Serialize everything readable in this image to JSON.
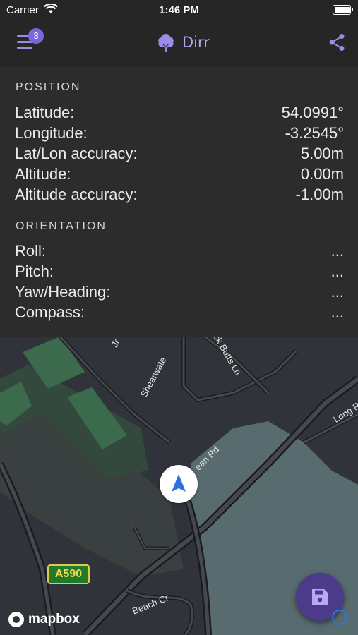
{
  "status_bar": {
    "carrier": "Carrier",
    "time": "1:46 PM"
  },
  "nav": {
    "badge_count": "3",
    "app_name": "Dirr",
    "accent": "#9d8bea"
  },
  "position": {
    "title": "POSITION",
    "rows": [
      {
        "label": "Latitude:",
        "value": "54.0991°"
      },
      {
        "label": "Longitude:",
        "value": "-3.2545°"
      },
      {
        "label": "Lat/Lon accuracy:",
        "value": "5.00m"
      },
      {
        "label": "Altitude:",
        "value": "0.00m"
      },
      {
        "label": "Altitude accuracy:",
        "value": "-1.00m"
      }
    ]
  },
  "orientation": {
    "title": "ORIENTATION",
    "rows": [
      {
        "label": "Roll:",
        "value": "..."
      },
      {
        "label": "Pitch:",
        "value": "..."
      },
      {
        "label": "Yaw/Heading:",
        "value": "..."
      },
      {
        "label": "Compass:",
        "value": "..."
      }
    ]
  },
  "map": {
    "road_labels": {
      "shearwater": "Shearwate",
      "butts": "ck Butts Ln",
      "ocean": "ean Rd",
      "long": "Long R",
      "beach": "Beach Cr",
      "jr": "Jr"
    },
    "road_sign": "A590",
    "attribution": "mapbox",
    "info": "i"
  },
  "icons": {
    "menu": "menu-icon",
    "share": "share-icon",
    "logo": "tree-icon",
    "location": "navigation-arrow-icon",
    "save": "save-icon"
  }
}
